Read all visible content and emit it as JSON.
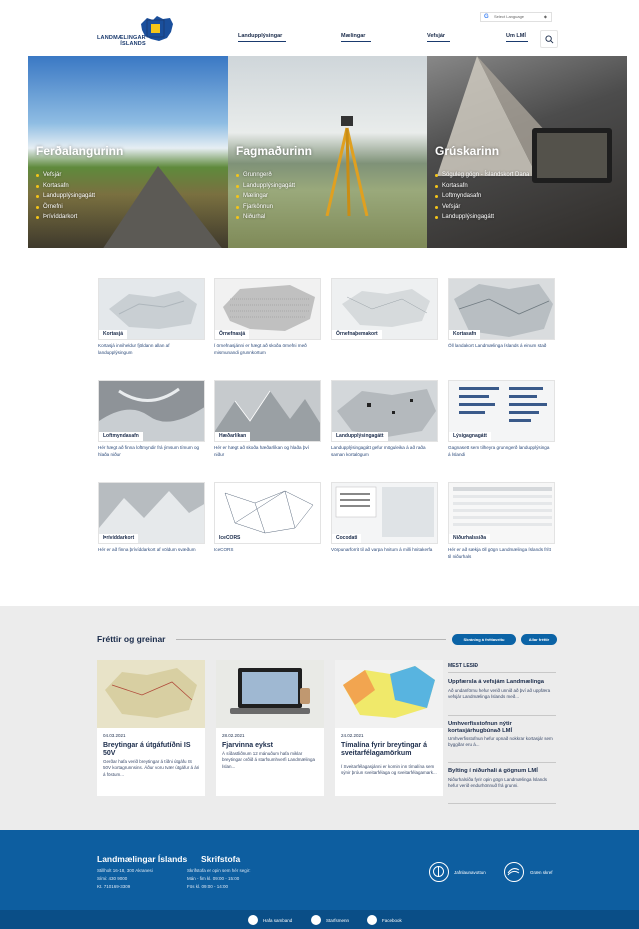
{
  "header": {
    "logo_line1": "LANDMÆLINGAR",
    "logo_line2": "ÍSLANDS",
    "nav": [
      "Landupplýsingar",
      "Mælingar",
      "Vefsjár",
      "Um LMÍ"
    ],
    "language_label": "Select Language",
    "icons": [
      "google-icon",
      "caret-icon",
      "search-icon"
    ]
  },
  "hero": [
    {
      "title": "Ferðalangurinn",
      "items": [
        "Vefsjár",
        "Kortasafn",
        "Landupplýsingagátt",
        "Örnefni",
        "Þrívíddarkort"
      ]
    },
    {
      "title": "Fagmaðurinn",
      "items": [
        "Grunngerð",
        "Landupplýsingagátt",
        "Mælingar",
        "Fjarkönnun",
        "Niðurhal"
      ]
    },
    {
      "title": "Grúskarinn",
      "items": [
        "Söguleg gögn - Íslandskort Dana",
        "Kortasafn",
        "Loftmyndasafn",
        "Vefsjár",
        "Landupplýsingagátt"
      ]
    }
  ],
  "services": [
    {
      "label": "Kortasjá",
      "desc": "Kortasjá inniheldur fjöldann allan af landupplýsingum"
    },
    {
      "label": "Örnefnasjá",
      "desc": "Í örnefnasjánni er hægt að skoða örnefni með mismunandi grunnkortum"
    },
    {
      "label": "Örnefnaþemakort",
      "desc": ""
    },
    {
      "label": "Kortasafn",
      "desc": "Öll landakort Landmælinga Íslands á einum stað"
    },
    {
      "label": "Loftmyndasafn",
      "desc": "Hér hægt að finna loftmyndir frá ýmsum tímum og hlaða niður"
    },
    {
      "label": "Hæðarlíkan",
      "desc": "Hér er hægt að skoða hæðarlíkan og hlaða því niður"
    },
    {
      "label": "Landupplýsingagátt",
      "desc": "Landupplýsingagátt gefur möguleika á að raða saman kortalögum"
    },
    {
      "label": "Lýsigagnagátt",
      "desc": "Gagnasett sem tilheyra grunngerð landupplýsinga á Íslandi"
    },
    {
      "label": "Þrívíddarkort",
      "desc": "Hér er að finna þrívíddarkort af völdum svæðum"
    },
    {
      "label": "IceCORS",
      "desc": "IceCORS"
    },
    {
      "label": "Cocodati",
      "desc": "Vörpunarforrit til að varpa hnitum á milli hnitakerfa"
    },
    {
      "label": "Niðurhalssíða",
      "desc": "Hér er að sækja öll gögn Landmælinga Íslands frítt til niðurhals"
    }
  ],
  "news": {
    "heading": "Fréttir og greinar",
    "subscribe_label": "Skráning á fréttaveitu",
    "all_label": "Allar fréttir",
    "cards": [
      {
        "date": "04.03.2021",
        "title": "Breytingar á útgáfutíðni IS 50V",
        "text": "Gerðar hafa verið breytingar á tíðni útgáfu IS 50V kortagrunnsins. Áður voru tvær útgáfur á ári á föstum..."
      },
      {
        "date": "28.02.2021",
        "title": "Fjarvinna eykst",
        "text": "Á síðastliðnum 12 mánuðum hafa miklar breytingar orðið á starfsumhverfi Landmælinga Íslan..."
      },
      {
        "date": "24.02.2021",
        "title": "Tímalína fyrir breytingar á sveitarfélagamörkum",
        "text": "Í Sveitarfélagasjánni er komin inn tímalína sem sýnir þróun sveitarfélaga og sveitarfélagamark..."
      }
    ],
    "most_read_heading": "MEST LESIÐ",
    "most_read": [
      {
        "title": "Uppfærsla á vefsjám Landmælinga",
        "text": "Að undanförnu hefur verið unnið að því að uppfæra vefsjár Landmælinga Íslands með..."
      },
      {
        "title": "Umhverfisstofnun nýtir kortasjárhugbúnað LMÍ",
        "text": "Umhverfisstofnun hefur opnað nokkrar kortasjár sem byggðar eru á..."
      },
      {
        "title": "Bylting í niðurhali á gögnum LMÍ",
        "text": "Niðurhalsíða fyrir opin gögn Landmælinga Íslands hefur verið endurhönnuð frá grunni."
      }
    ]
  },
  "footer": {
    "org_name": "Landmælingar Íslands",
    "address": "Stillholt 16-18, 300 Akranesi",
    "phone": "Sími: 430 9000",
    "kt": "Kt. 710169-3309",
    "office_head": "Skrifstofa",
    "office_line1": "Skrifstofa er opin sem hér segir:",
    "office_line2": "Mán - fim kl. 09:00 - 15:00",
    "office_line3": "Fös kl. 09:00 - 14:00",
    "badge1": "Jafnlaunavottun",
    "badge2": "Græn skref",
    "bottom_links": [
      "Hafa samband",
      "Starfsmenn",
      "Facebook"
    ]
  },
  "colors": {
    "primary": "#0d5ea0",
    "accent": "#f5c518",
    "text": "#1a2b4a"
  }
}
